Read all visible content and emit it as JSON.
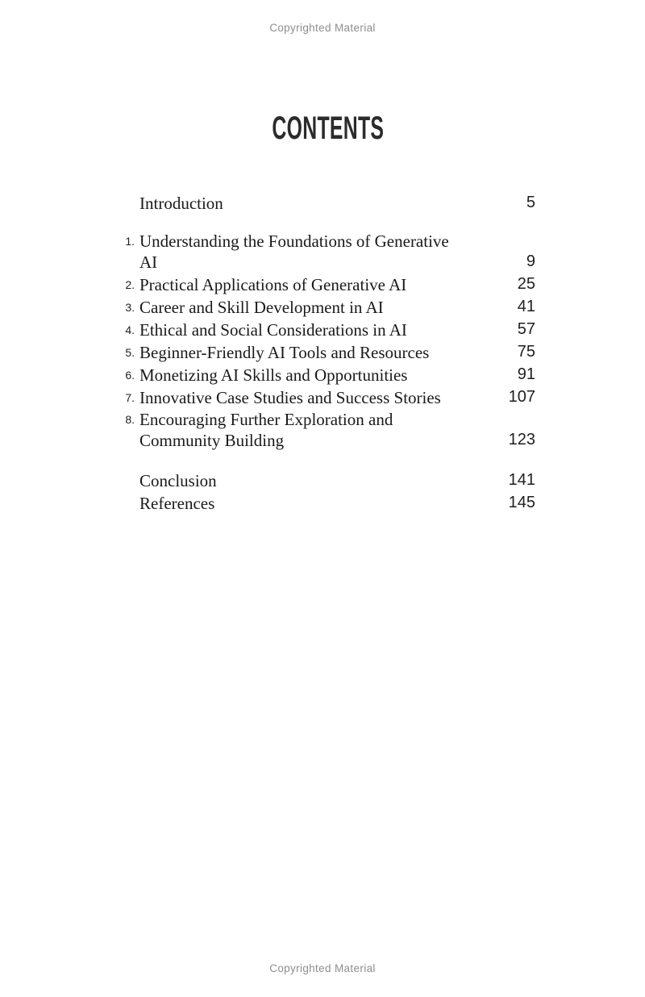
{
  "page": {
    "watermark_top": "Copyrighted Material",
    "watermark_bottom": "Copyrighted Material",
    "title": "CONTENTS",
    "colors": {
      "background": "#ffffff",
      "body_text": "#1a1a1a",
      "title_text": "#2b2b2b",
      "watermark_text": "#8e8e8e"
    }
  },
  "toc": {
    "entries": [
      {
        "number": "",
        "title": "Introduction",
        "page": "5"
      },
      {
        "number": "1.",
        "title": "Understanding the Foundations of Generative AI",
        "page": "9"
      },
      {
        "number": "2.",
        "title": "Practical Applications of Generative AI",
        "page": "25"
      },
      {
        "number": "3.",
        "title": "Career and Skill Development in AI",
        "page": "41"
      },
      {
        "number": "4.",
        "title": "Ethical and Social Considerations in AI",
        "page": "57"
      },
      {
        "number": "5.",
        "title": "Beginner-Friendly AI Tools and Resources",
        "page": "75"
      },
      {
        "number": "6.",
        "title": "Monetizing AI Skills and Opportunities",
        "page": "91"
      },
      {
        "number": "7.",
        "title": "Innovative Case Studies and Success Stories",
        "page": "107"
      },
      {
        "number": "8.",
        "title": "Encouraging Further Exploration and Community Building",
        "page": "123"
      },
      {
        "number": "",
        "title": "Conclusion",
        "page": "141"
      },
      {
        "number": "",
        "title": "References",
        "page": "145"
      }
    ]
  }
}
